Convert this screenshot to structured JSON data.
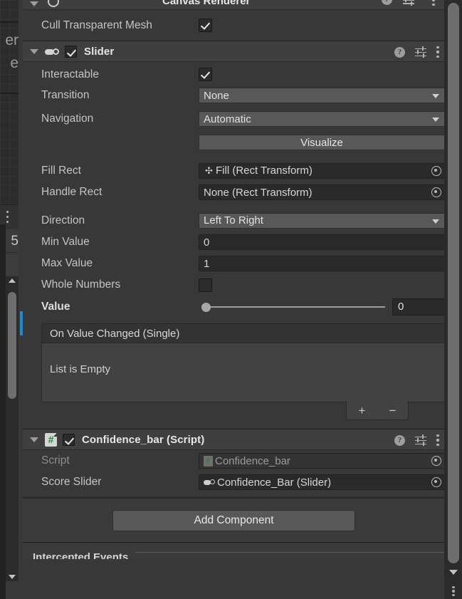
{
  "left_pane": {
    "cut_text_1": "er",
    "cut_text_2": "e",
    "cut_number": "5",
    "kebab_icon": "kebab-menu-icon",
    "scroll_up_icon": "scroll-up-arrow-icon",
    "scroll_down_icon": "scroll-down-arrow-icon"
  },
  "canvas_renderer": {
    "title": "Canvas Renderer",
    "foldout_icon": "foldout-open-icon",
    "component_icon": "canvas-renderer-icon",
    "help_icon": "help-icon",
    "preset_icon": "preset-icon",
    "kebab_icon": "kebab-menu-icon",
    "cull_transparent_mesh": {
      "label": "Cull Transparent Mesh",
      "checked": true
    }
  },
  "slider_component": {
    "title": "Slider",
    "enabled": true,
    "foldout_icon": "foldout-open-icon",
    "component_icon": "slider-icon",
    "help_icon": "help-icon",
    "preset_icon": "preset-icon",
    "kebab_icon": "kebab-menu-icon",
    "properties": {
      "interactable": {
        "label": "Interactable",
        "checked": true
      },
      "transition": {
        "label": "Transition",
        "value": "None"
      },
      "navigation": {
        "label": "Navigation",
        "value": "Automatic"
      },
      "visualize": {
        "label": "Visualize"
      },
      "fill_rect": {
        "label": "Fill Rect",
        "value": "Fill (Rect Transform)",
        "icon": "rect-transform-icon"
      },
      "handle_rect": {
        "label": "Handle Rect",
        "value": "None (Rect Transform)"
      },
      "direction": {
        "label": "Direction",
        "value": "Left To Right"
      },
      "min_value": {
        "label": "Min Value",
        "value": "0"
      },
      "max_value": {
        "label": "Max Value",
        "value": "1"
      },
      "whole_numbers": {
        "label": "Whole Numbers",
        "checked": false
      },
      "value": {
        "label": "Value",
        "value": "0",
        "slider_position_pct": 0,
        "overridden": true
      }
    },
    "event_list": {
      "header": "On Value Changed (Single)",
      "empty_text": "List is Empty",
      "add_label": "+",
      "remove_label": "−"
    }
  },
  "confidence_bar_component": {
    "title": "Confidence_bar (Script)",
    "enabled": true,
    "foldout_icon": "foldout-open-icon",
    "component_icon": "csharp-script-icon",
    "help_icon": "help-icon",
    "preset_icon": "preset-icon",
    "kebab_icon": "kebab-menu-icon",
    "properties": {
      "script": {
        "label": "Script",
        "value": "Confidence_bar",
        "icon": "csharp-script-icon"
      },
      "score_slider": {
        "label": "Score Slider",
        "value": "Confidence_Bar (Slider)",
        "icon": "slider-icon"
      }
    }
  },
  "add_component": {
    "label": "Add Component"
  },
  "bottom_panel": {
    "title": "Intercepted Events"
  },
  "colors": {
    "panel_bg": "#383838",
    "header_bg": "#3f3f3f",
    "field_bg": "#2a2a2a",
    "dropdown_bg": "#585858",
    "override_marker": "#1d8ad4",
    "text": "#c4c4c4",
    "script_icon_green": "#1f8a32"
  }
}
